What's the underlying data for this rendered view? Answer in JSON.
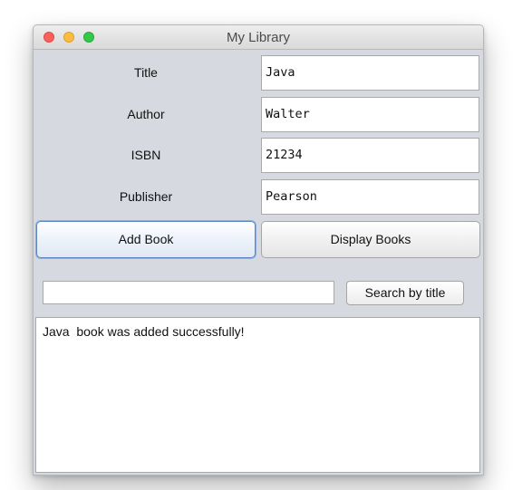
{
  "window": {
    "title": "My Library"
  },
  "form": {
    "fields": [
      {
        "label": "Title",
        "value": "Java"
      },
      {
        "label": "Author",
        "value": "Walter"
      },
      {
        "label": "ISBN",
        "value": "21234"
      },
      {
        "label": "Publisher",
        "value": "Pearson"
      }
    ]
  },
  "actions": {
    "add_label": "Add Book",
    "display_label": "Display Books"
  },
  "search": {
    "value": "",
    "button_label": "Search by title"
  },
  "output": {
    "text": "Java  book was added successfully!"
  },
  "colors": {
    "close": "#fc605b",
    "minimize": "#fdbc40",
    "maximize": "#34c84a",
    "panel_background": "#d6d9df",
    "focus_ring": "#5c85c4"
  },
  "icons": [
    "close-window-icon",
    "minimize-window-icon",
    "maximize-window-icon"
  ]
}
